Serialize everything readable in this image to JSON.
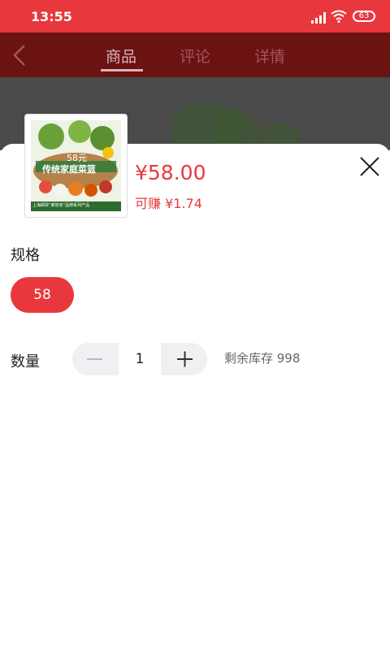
{
  "status_bar": {
    "time": "13:55",
    "battery": "63"
  },
  "nav": {
    "tabs": [
      {
        "label": "商品",
        "active": true
      },
      {
        "label": "评论"
      },
      {
        "label": "详情"
      }
    ]
  },
  "product": {
    "image_text_price": "58元",
    "image_text_title": "传统家庭菜篮",
    "image_text_brand": "上海邮政“邮管家”品牌系列产品",
    "price": "¥58.00",
    "earn": "可赚 ¥1.74"
  },
  "spec": {
    "label": "规格",
    "options": [
      "58"
    ],
    "selected": "58"
  },
  "quantity": {
    "label": "数量",
    "value": "1",
    "stock_text": "剩余库存 998"
  },
  "colors": {
    "accent": "#e8383d",
    "nav_dim": "#6b1213"
  }
}
